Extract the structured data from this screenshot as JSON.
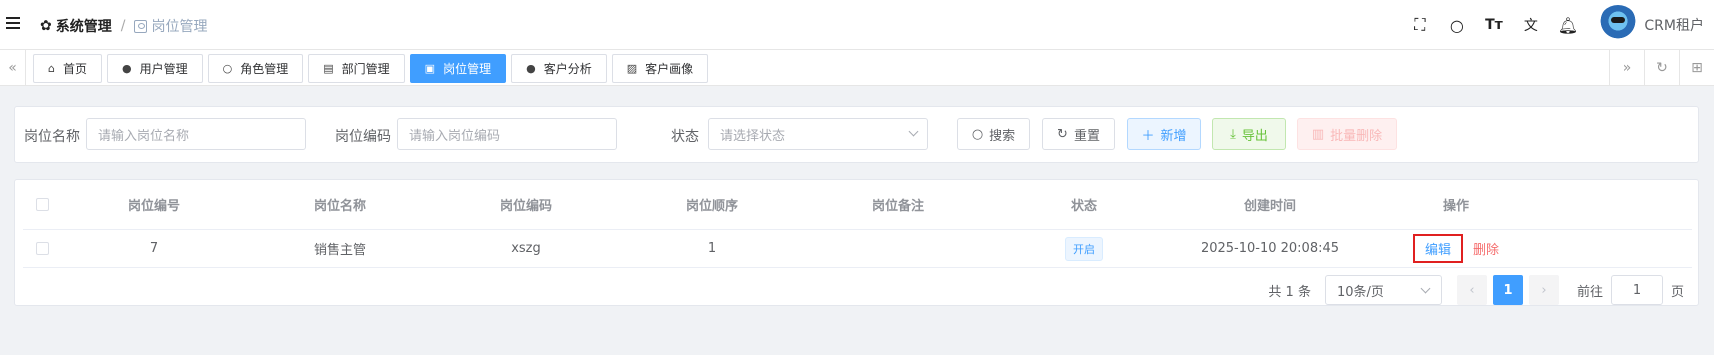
{
  "header": {
    "breadcrumb_home": "系统管理",
    "breadcrumb_current": "岗位管理",
    "tenant": "CRM租户",
    "tool_icons": [
      "fullscreen-icon",
      "search-icon",
      "font-size-icon",
      "translate-icon",
      "bell-icon"
    ]
  },
  "tabs": [
    {
      "label": "首页",
      "icon": "home-icon",
      "active": false
    },
    {
      "label": "用户管理",
      "icon": "user-icon",
      "active": false
    },
    {
      "label": "角色管理",
      "icon": "user-outline-icon",
      "active": false
    },
    {
      "label": "部门管理",
      "icon": "id-card-icon",
      "active": false
    },
    {
      "label": "岗位管理",
      "icon": "badge-icon",
      "active": true
    },
    {
      "label": "客户分析",
      "icon": "user-icon",
      "active": false
    },
    {
      "label": "客户画像",
      "icon": "picture-icon",
      "active": false
    }
  ],
  "search": {
    "name_label": "岗位名称",
    "name_placeholder": "请输入岗位名称",
    "code_label": "岗位编码",
    "code_placeholder": "请输入岗位编码",
    "status_label": "状态",
    "status_placeholder": "请选择状态",
    "search_btn": "搜索",
    "reset_btn": "重置",
    "add_btn": "新增",
    "export_btn": "导出",
    "batch_delete_btn": "批量删除"
  },
  "table": {
    "columns": [
      "岗位编号",
      "岗位名称",
      "岗位编码",
      "岗位顺序",
      "岗位备注",
      "状态",
      "创建时间",
      "操作"
    ],
    "rows": [
      {
        "id": "7",
        "name": "销售主管",
        "code": "xszg",
        "order": "1",
        "remark": "",
        "status": "开启",
        "created": "2025-10-10 20:08:45",
        "edit": "编辑",
        "delete": "删除"
      }
    ]
  },
  "pagination": {
    "total": "共 1 条",
    "page_size": "10条/页",
    "current_page": "1",
    "goto_label": "前往",
    "goto_value": "1",
    "page_suffix": "页"
  }
}
